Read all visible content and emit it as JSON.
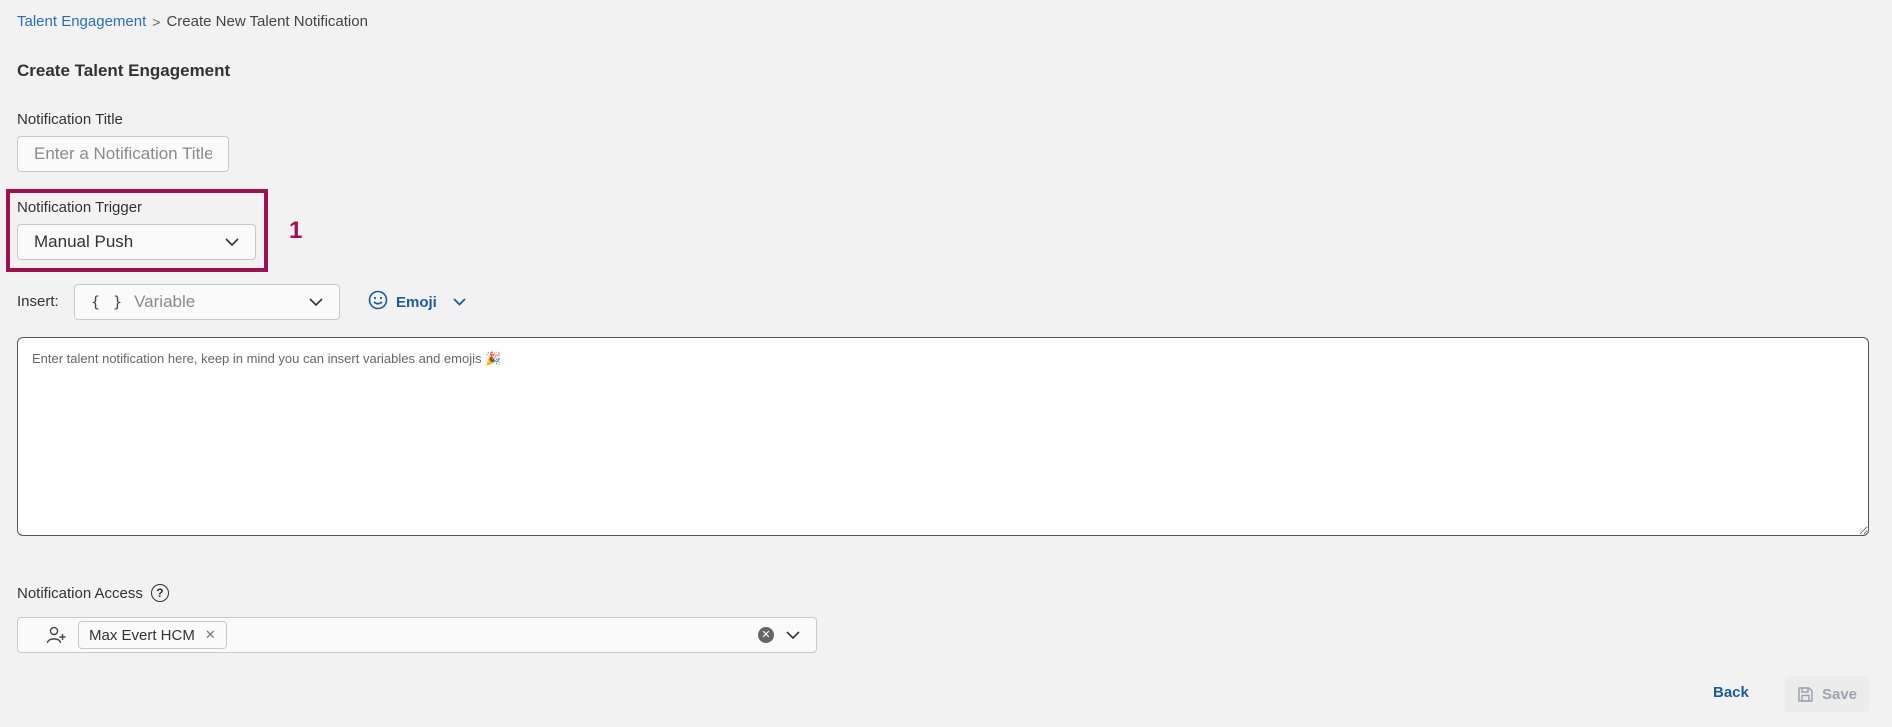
{
  "breadcrumb": {
    "parent": "Talent Engagement",
    "separator": ">",
    "current": "Create New Talent Notification"
  },
  "page_title": "Create Talent Engagement",
  "notification_title": {
    "label": "Notification Title",
    "placeholder": "Enter a Notification Title",
    "value": ""
  },
  "notification_trigger": {
    "label": "Notification Trigger",
    "selected": "Manual Push"
  },
  "annotation": {
    "number": "1",
    "color": "#a3104f"
  },
  "insert": {
    "label": "Insert:",
    "variable_icon_text": "{ }",
    "variable_placeholder": "Variable",
    "emoji_label": "Emoji"
  },
  "message": {
    "placeholder": "Enter talent notification here, keep in mind you can insert variables and emojis 🎉",
    "value": ""
  },
  "notification_access": {
    "label": "Notification Access",
    "help_icon_text": "?",
    "selected_chips": [
      "Max Evert HCM"
    ]
  },
  "footer": {
    "back_label": "Back",
    "save_label": "Save"
  },
  "colors": {
    "link": "#2a6fb0",
    "accent": "#1d5c9a",
    "highlight": "#a3104f",
    "background": "#f2f2f2"
  }
}
